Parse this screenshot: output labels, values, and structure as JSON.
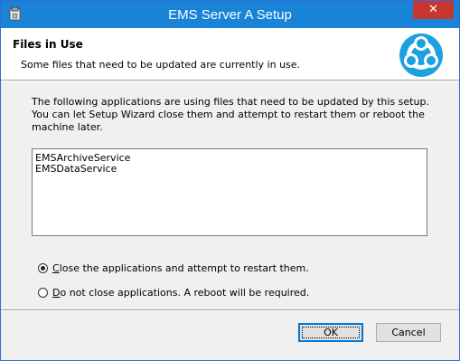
{
  "window": {
    "title": "EMS Server A Setup",
    "close_label": "✕"
  },
  "header": {
    "title": "Files in Use",
    "subtitle": "Some files that need to be updated are currently in use."
  },
  "body": {
    "description": "The following applications are using files that need to be updated by this setup. You can let Setup Wizard close them and attempt to restart them or reboot the machine later.",
    "applications": [
      "EMSArchiveService",
      "EMSDataService"
    ]
  },
  "options": {
    "close_apps": {
      "mnemonic": "C",
      "rest": "lose the applications and attempt to restart them.",
      "selected": true
    },
    "do_not_close": {
      "mnemonic": "D",
      "rest": "o not close applications. A reboot will be required.",
      "selected": false
    }
  },
  "buttons": {
    "ok": "OK",
    "cancel": "Cancel"
  },
  "colors": {
    "titlebar": "#1883d7",
    "logo": "#1ba1e2",
    "close": "#c7372f"
  },
  "icons": {
    "app": "installer-icon",
    "logo": "ems-logo-icon",
    "close": "close-icon"
  }
}
